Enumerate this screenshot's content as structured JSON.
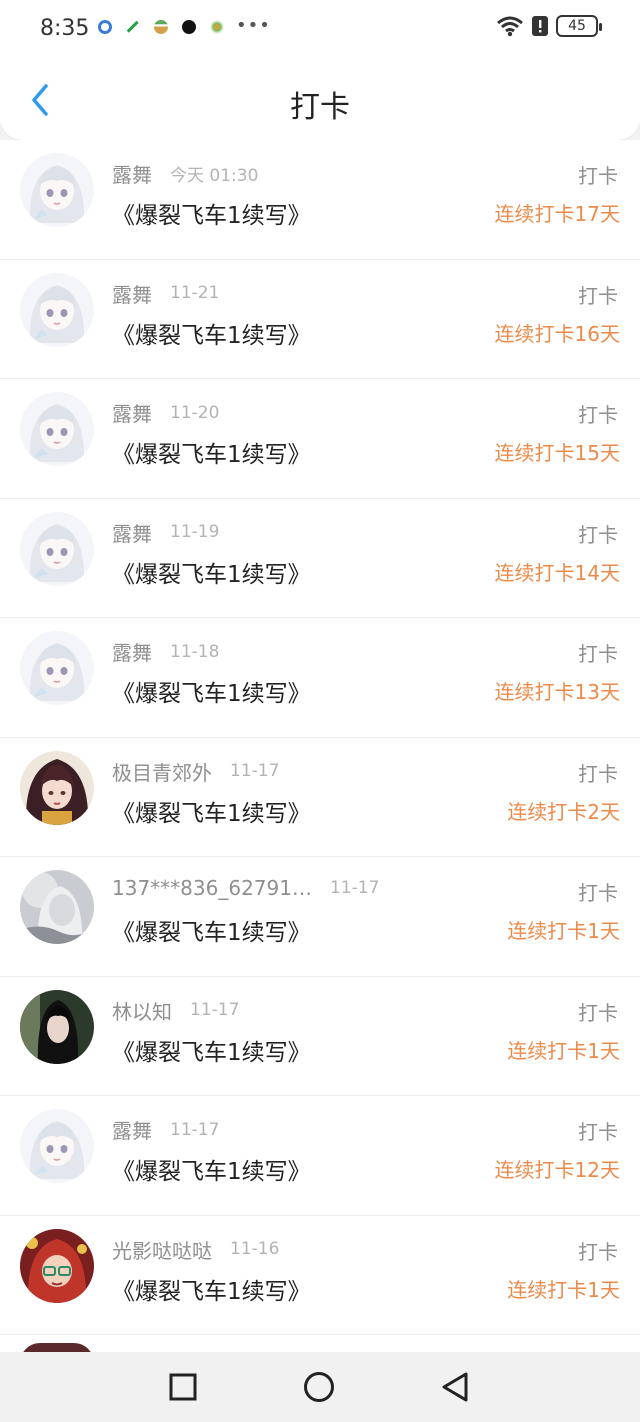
{
  "status_bar": {
    "time": "8:35",
    "battery": "45",
    "icons": [
      "app-icon-1",
      "app-icon-2",
      "app-icon-3",
      "app-icon-4",
      "app-icon-5",
      "more-icon",
      "wifi-icon",
      "alert-icon",
      "battery-icon"
    ],
    "more": "•••"
  },
  "header": {
    "title": "打卡",
    "back_icon": "chevron-left-icon"
  },
  "colors": {
    "accent": "#2e9bea",
    "streak": "#ec8a4a",
    "meta": "#8f8f8f",
    "date": "#b3b3b3"
  },
  "rows": [
    {
      "name": "露舞",
      "date": "今天 01:30",
      "title": "《爆裂飞车1续写》",
      "label": "打卡",
      "streak": "连续打卡17天"
    },
    {
      "name": "露舞",
      "date": "11-21",
      "title": "《爆裂飞车1续写》",
      "label": "打卡",
      "streak": "连续打卡16天"
    },
    {
      "name": "露舞",
      "date": "11-20",
      "title": "《爆裂飞车1续写》",
      "label": "打卡",
      "streak": "连续打卡15天"
    },
    {
      "name": "露舞",
      "date": "11-19",
      "title": "《爆裂飞车1续写》",
      "label": "打卡",
      "streak": "连续打卡14天"
    },
    {
      "name": "露舞",
      "date": "11-18",
      "title": "《爆裂飞车1续写》",
      "label": "打卡",
      "streak": "连续打卡13天"
    },
    {
      "name": "极目青郊外",
      "date": "11-17",
      "title": "《爆裂飞车1续写》",
      "label": "打卡",
      "streak": "连续打卡2天"
    },
    {
      "name": "137***836_62791…",
      "date": "11-17",
      "title": "《爆裂飞车1续写》",
      "label": "打卡",
      "streak": "连续打卡1天"
    },
    {
      "name": "林以知",
      "date": "11-17",
      "title": "《爆裂飞车1续写》",
      "label": "打卡",
      "streak": "连续打卡1天"
    },
    {
      "name": "露舞",
      "date": "11-17",
      "title": "《爆裂飞车1续写》",
      "label": "打卡",
      "streak": "连续打卡12天"
    },
    {
      "name": "光影哒哒哒",
      "date": "11-16",
      "title": "《爆裂飞车1续写》",
      "label": "打卡",
      "streak": "连续打卡1天"
    }
  ],
  "nav": {
    "icons": [
      "square-icon",
      "circle-icon",
      "triangle-back-icon"
    ]
  }
}
